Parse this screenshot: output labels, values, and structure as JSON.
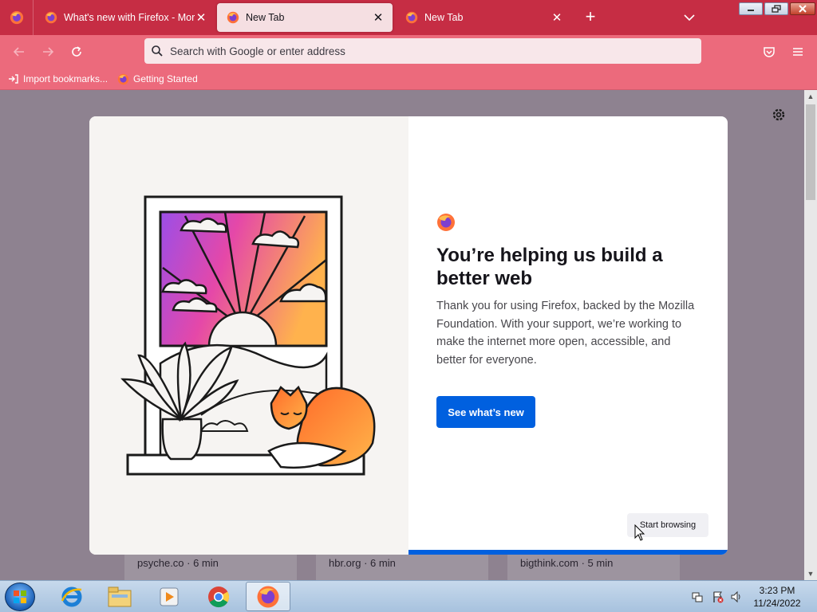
{
  "browser": {
    "tabs": [
      {
        "title": "What's new with Firefox - More",
        "active": false
      },
      {
        "title": "New Tab",
        "active": true
      },
      {
        "title": "New Tab",
        "active": false
      }
    ],
    "tab_close_glyph": "✕",
    "new_tab_glyph": "+",
    "urlbar_placeholder": "Search with Google or enter address",
    "bookmarks": [
      {
        "label": "Import bookmarks...",
        "icon": "import-icon"
      },
      {
        "label": "Getting Started",
        "icon": "firefox-icon"
      }
    ],
    "colors": {
      "tabstrip": "#c62d44",
      "toolbar": "#ec6a7c",
      "accent": "#0060df"
    }
  },
  "modal": {
    "title": "You’re helping us build a better web",
    "body": "Thank you for using Firefox, backed by the Mozilla Foundation. With your support, we’re working to make the internet more open, accessible, and better for everyone.",
    "primary_button": "See what’s new",
    "secondary_button": "Start browsing",
    "progress_fraction": 1.0
  },
  "stories": [
    {
      "source": "psyche.co · 6 min"
    },
    {
      "source": "hbr.org · 6 min"
    },
    {
      "source": "bigthink.com · 5 min"
    }
  ],
  "taskbar": {
    "time": "3:23 PM",
    "date": "11/24/2022",
    "apps": [
      "start-button",
      "internet-explorer-icon",
      "file-explorer-icon",
      "media-player-icon",
      "chrome-icon",
      "firefox-icon"
    ]
  }
}
